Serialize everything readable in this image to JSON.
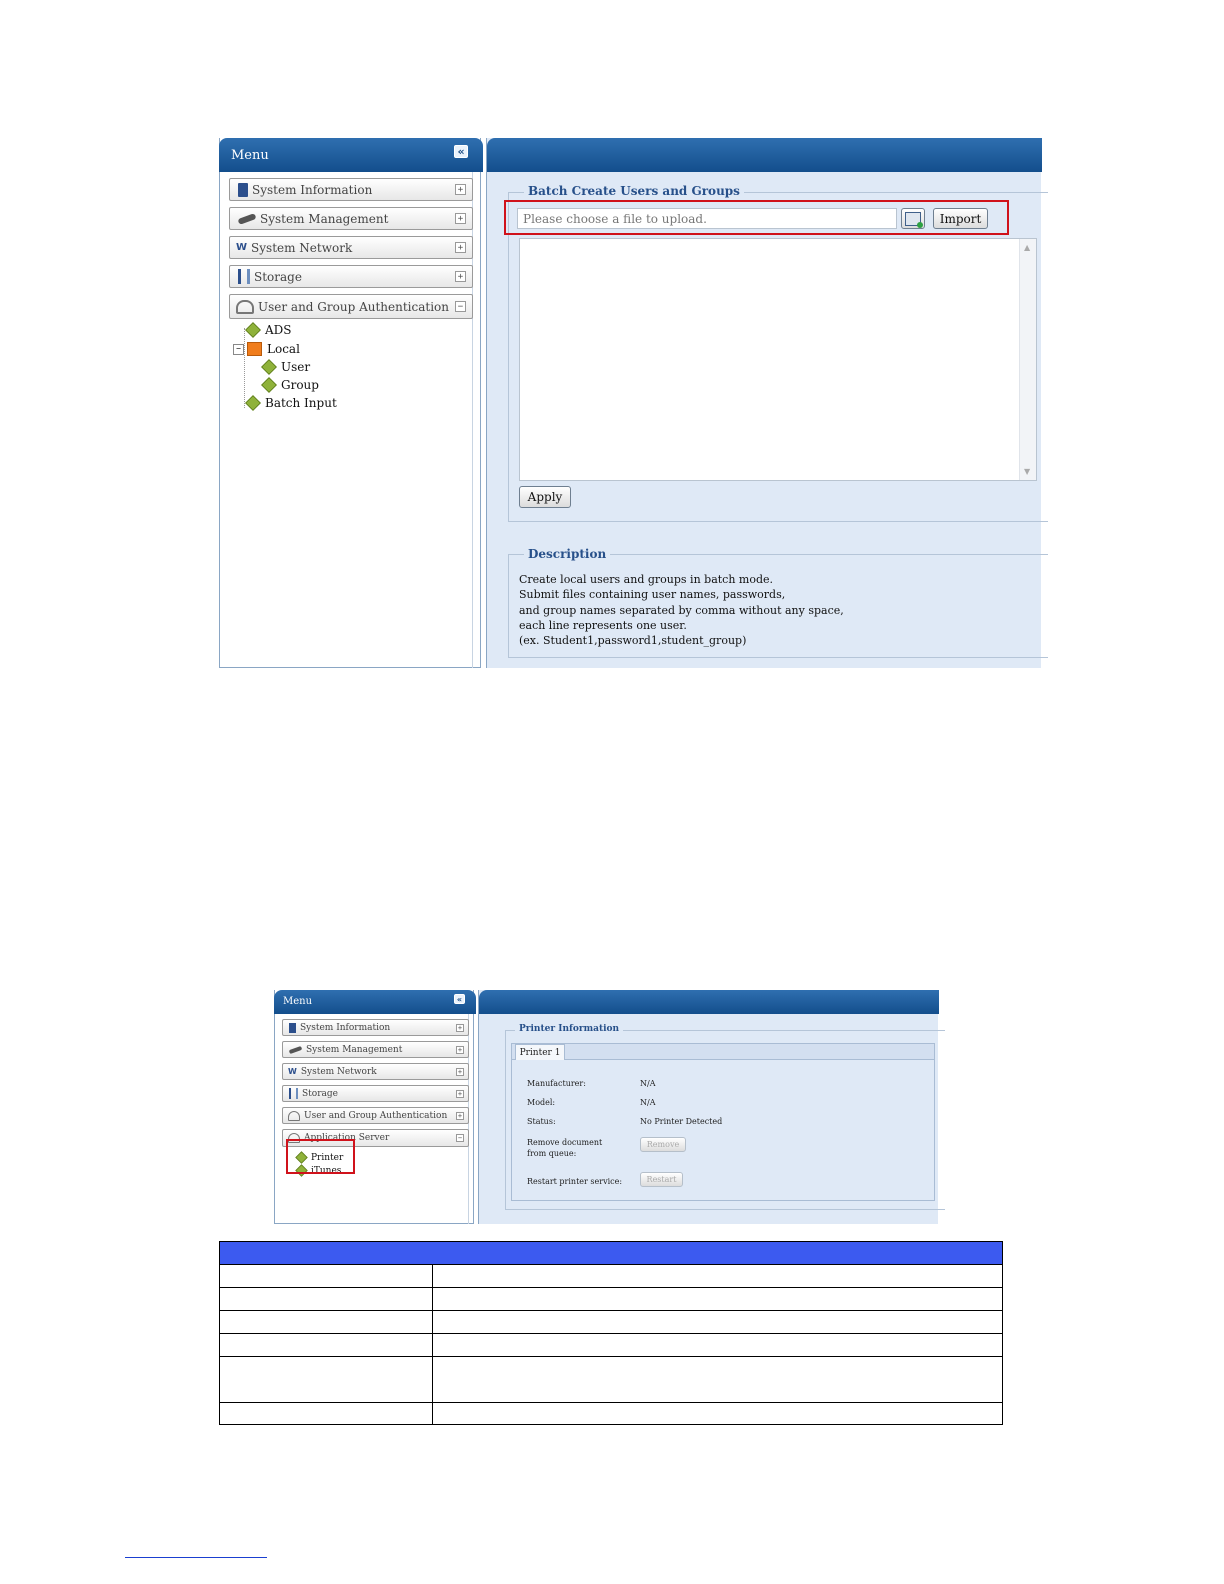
{
  "screenshot1": {
    "menu": {
      "title": "Menu",
      "collapse_glyph": "«",
      "items": [
        {
          "label": "System Information",
          "icon": "book-icon",
          "toggle": "+"
        },
        {
          "label": "System Management",
          "icon": "wrench-icon",
          "toggle": "+"
        },
        {
          "label": "System Network",
          "icon": "network-icon",
          "toggle": "+"
        },
        {
          "label": "Storage",
          "icon": "storage-icon",
          "toggle": "+"
        },
        {
          "label": "User and Group Authentication",
          "icon": "user-group-icon",
          "toggle": "−"
        }
      ],
      "tree": [
        {
          "label": "ADS"
        },
        {
          "label": "Local",
          "expander": "−"
        },
        {
          "label": "User"
        },
        {
          "label": "Group"
        },
        {
          "label": "Batch Input"
        }
      ]
    },
    "batch": {
      "legend": "Batch Create Users and Groups",
      "file_placeholder": "Please choose a file to upload.",
      "browse_icon": "browse-file-icon",
      "import_label": "Import",
      "apply_label": "Apply"
    },
    "description": {
      "legend": "Description",
      "lines": [
        "Create local users and groups in batch mode.",
        "Submit files containing user names, passwords,",
        "and group names separated by comma without any space,",
        "each line represents one user.",
        "(ex. Student1,password1,student_group)"
      ]
    }
  },
  "screenshot2": {
    "menu": {
      "title": "Menu",
      "collapse_glyph": "«",
      "items": [
        {
          "label": "System Information",
          "icon": "book-icon",
          "toggle": "+"
        },
        {
          "label": "System Management",
          "icon": "wrench-icon",
          "toggle": "+"
        },
        {
          "label": "System Network",
          "icon": "network-icon",
          "toggle": "+"
        },
        {
          "label": "Storage",
          "icon": "storage-icon",
          "toggle": "+"
        },
        {
          "label": "User and Group Authentication",
          "icon": "user-group-icon",
          "toggle": "+"
        },
        {
          "label": "Application Server",
          "icon": "app-server-icon",
          "toggle": "−"
        }
      ],
      "tree": [
        {
          "label": "Printer"
        },
        {
          "label": "iTunes"
        }
      ]
    },
    "printer": {
      "legend": "Printer Information",
      "tab": "Printer 1",
      "rows": [
        {
          "label": "Manufacturer:",
          "value": "N/A"
        },
        {
          "label": "Model:",
          "value": "N/A"
        },
        {
          "label": "Status:",
          "value": "No Printer Detected"
        }
      ],
      "remove_label_1": "Remove document",
      "remove_label_2": "from queue:",
      "remove_button": "Remove",
      "restart_label": "Restart printer service:",
      "restart_button": "Restart"
    }
  },
  "table": {
    "rows": [
      [
        "",
        ""
      ],
      [
        "",
        ""
      ],
      [
        "",
        ""
      ],
      [
        "",
        ""
      ],
      [
        "",
        ""
      ],
      [
        "",
        ""
      ]
    ]
  }
}
